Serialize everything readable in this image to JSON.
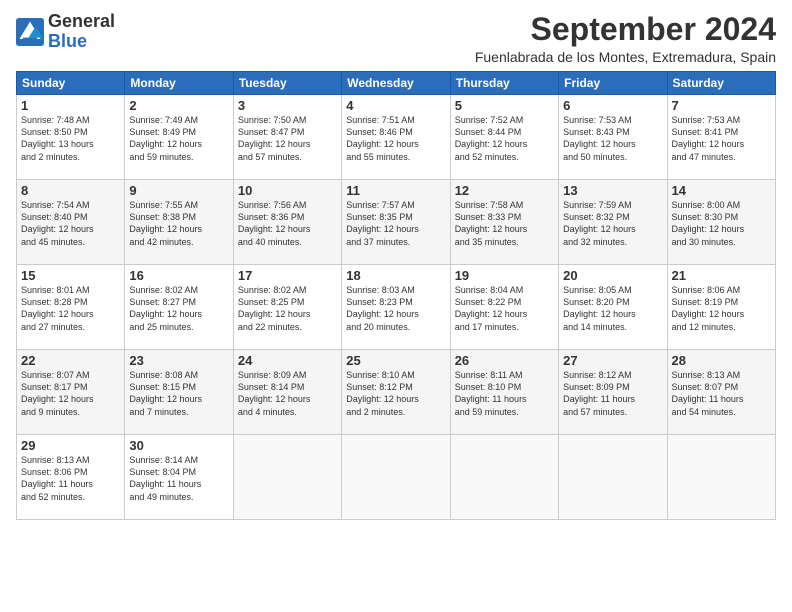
{
  "header": {
    "logo": {
      "line1": "General",
      "line2": "Blue"
    },
    "title": "September 2024",
    "location": "Fuenlabrada de los Montes, Extremadura, Spain"
  },
  "days_of_week": [
    "Sunday",
    "Monday",
    "Tuesday",
    "Wednesday",
    "Thursday",
    "Friday",
    "Saturday"
  ],
  "weeks": [
    [
      {
        "day": 1,
        "info": "Sunrise: 7:48 AM\nSunset: 8:50 PM\nDaylight: 13 hours\nand 2 minutes."
      },
      {
        "day": 2,
        "info": "Sunrise: 7:49 AM\nSunset: 8:49 PM\nDaylight: 12 hours\nand 59 minutes."
      },
      {
        "day": 3,
        "info": "Sunrise: 7:50 AM\nSunset: 8:47 PM\nDaylight: 12 hours\nand 57 minutes."
      },
      {
        "day": 4,
        "info": "Sunrise: 7:51 AM\nSunset: 8:46 PM\nDaylight: 12 hours\nand 55 minutes."
      },
      {
        "day": 5,
        "info": "Sunrise: 7:52 AM\nSunset: 8:44 PM\nDaylight: 12 hours\nand 52 minutes."
      },
      {
        "day": 6,
        "info": "Sunrise: 7:53 AM\nSunset: 8:43 PM\nDaylight: 12 hours\nand 50 minutes."
      },
      {
        "day": 7,
        "info": "Sunrise: 7:53 AM\nSunset: 8:41 PM\nDaylight: 12 hours\nand 47 minutes."
      }
    ],
    [
      {
        "day": 8,
        "info": "Sunrise: 7:54 AM\nSunset: 8:40 PM\nDaylight: 12 hours\nand 45 minutes."
      },
      {
        "day": 9,
        "info": "Sunrise: 7:55 AM\nSunset: 8:38 PM\nDaylight: 12 hours\nand 42 minutes."
      },
      {
        "day": 10,
        "info": "Sunrise: 7:56 AM\nSunset: 8:36 PM\nDaylight: 12 hours\nand 40 minutes."
      },
      {
        "day": 11,
        "info": "Sunrise: 7:57 AM\nSunset: 8:35 PM\nDaylight: 12 hours\nand 37 minutes."
      },
      {
        "day": 12,
        "info": "Sunrise: 7:58 AM\nSunset: 8:33 PM\nDaylight: 12 hours\nand 35 minutes."
      },
      {
        "day": 13,
        "info": "Sunrise: 7:59 AM\nSunset: 8:32 PM\nDaylight: 12 hours\nand 32 minutes."
      },
      {
        "day": 14,
        "info": "Sunrise: 8:00 AM\nSunset: 8:30 PM\nDaylight: 12 hours\nand 30 minutes."
      }
    ],
    [
      {
        "day": 15,
        "info": "Sunrise: 8:01 AM\nSunset: 8:28 PM\nDaylight: 12 hours\nand 27 minutes."
      },
      {
        "day": 16,
        "info": "Sunrise: 8:02 AM\nSunset: 8:27 PM\nDaylight: 12 hours\nand 25 minutes."
      },
      {
        "day": 17,
        "info": "Sunrise: 8:02 AM\nSunset: 8:25 PM\nDaylight: 12 hours\nand 22 minutes."
      },
      {
        "day": 18,
        "info": "Sunrise: 8:03 AM\nSunset: 8:23 PM\nDaylight: 12 hours\nand 20 minutes."
      },
      {
        "day": 19,
        "info": "Sunrise: 8:04 AM\nSunset: 8:22 PM\nDaylight: 12 hours\nand 17 minutes."
      },
      {
        "day": 20,
        "info": "Sunrise: 8:05 AM\nSunset: 8:20 PM\nDaylight: 12 hours\nand 14 minutes."
      },
      {
        "day": 21,
        "info": "Sunrise: 8:06 AM\nSunset: 8:19 PM\nDaylight: 12 hours\nand 12 minutes."
      }
    ],
    [
      {
        "day": 22,
        "info": "Sunrise: 8:07 AM\nSunset: 8:17 PM\nDaylight: 12 hours\nand 9 minutes."
      },
      {
        "day": 23,
        "info": "Sunrise: 8:08 AM\nSunset: 8:15 PM\nDaylight: 12 hours\nand 7 minutes."
      },
      {
        "day": 24,
        "info": "Sunrise: 8:09 AM\nSunset: 8:14 PM\nDaylight: 12 hours\nand 4 minutes."
      },
      {
        "day": 25,
        "info": "Sunrise: 8:10 AM\nSunset: 8:12 PM\nDaylight: 12 hours\nand 2 minutes."
      },
      {
        "day": 26,
        "info": "Sunrise: 8:11 AM\nSunset: 8:10 PM\nDaylight: 11 hours\nand 59 minutes."
      },
      {
        "day": 27,
        "info": "Sunrise: 8:12 AM\nSunset: 8:09 PM\nDaylight: 11 hours\nand 57 minutes."
      },
      {
        "day": 28,
        "info": "Sunrise: 8:13 AM\nSunset: 8:07 PM\nDaylight: 11 hours\nand 54 minutes."
      }
    ],
    [
      {
        "day": 29,
        "info": "Sunrise: 8:13 AM\nSunset: 8:06 PM\nDaylight: 11 hours\nand 52 minutes."
      },
      {
        "day": 30,
        "info": "Sunrise: 8:14 AM\nSunset: 8:04 PM\nDaylight: 11 hours\nand 49 minutes."
      },
      {
        "day": null,
        "info": ""
      },
      {
        "day": null,
        "info": ""
      },
      {
        "day": null,
        "info": ""
      },
      {
        "day": null,
        "info": ""
      },
      {
        "day": null,
        "info": ""
      }
    ]
  ]
}
